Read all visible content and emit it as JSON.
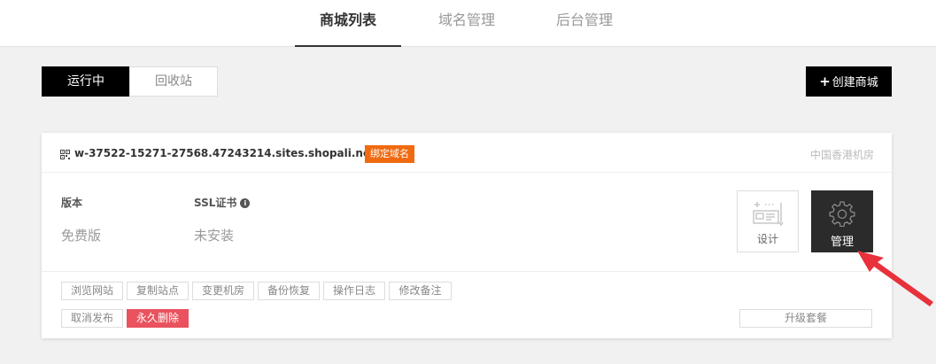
{
  "nav": {
    "tabs": [
      {
        "label": "商城列表",
        "active": true
      },
      {
        "label": "域名管理",
        "active": false
      },
      {
        "label": "后台管理",
        "active": false
      }
    ]
  },
  "filter": {
    "running": "运行中",
    "recycle": "回收站"
  },
  "create_button": "创建商城",
  "site": {
    "domain": "w-37522-15271-27568.47243214.sites.shopali.net",
    "bind_domain": "绑定域名",
    "region": "中国香港机房",
    "version_label": "版本",
    "version_value": "免费版",
    "ssl_label": "SSL证书",
    "ssl_value": "未安装",
    "design_label": "设计",
    "manage_label": "管理",
    "actions": [
      "浏览网站",
      "复制站点",
      "变更机房",
      "备份恢复",
      "操作日志",
      "修改备注"
    ],
    "unpublish": "取消发布",
    "delete_forever": "永久删除",
    "upgrade": "升级套餐"
  },
  "colors": {
    "accent": "#000000",
    "badge": "#f06a10",
    "danger": "#e9525e",
    "annotation_arrow": "#e8313b"
  }
}
